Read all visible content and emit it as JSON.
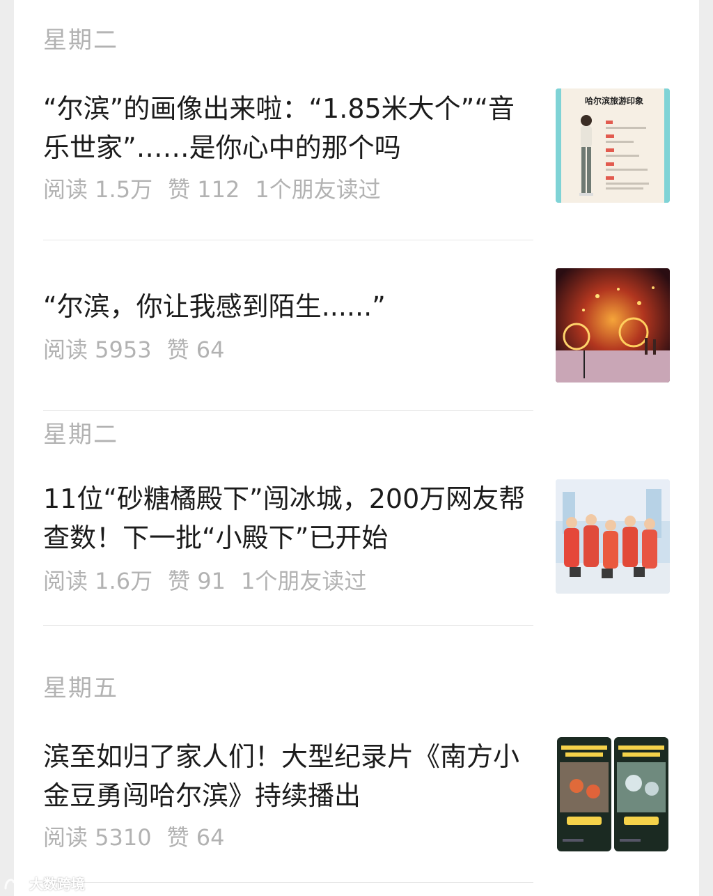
{
  "groups": [
    {
      "date": "星期二",
      "articles": [
        {
          "title": "“尔滨”的画像出来啦：“1.85米大个”“音乐世家”……是你心中的那个吗",
          "reads": "阅读 1.5万",
          "likes": "赞 112",
          "friends": "1个朋友读过",
          "thumb": {
            "caption": "哈尔滨旅游印象"
          }
        },
        {
          "title": "“尔滨，你让我感到陌生......”",
          "reads": "阅读 5953",
          "likes": "赞 64",
          "friends": ""
        }
      ]
    },
    {
      "date": "星期二",
      "articles": [
        {
          "title": "11位“砂糖橘殿下”闯冰城，200万网友帮查数！下一批“小殿下”已开始",
          "reads": "阅读 1.6万",
          "likes": "赞 91",
          "friends": "1个朋友读过"
        }
      ]
    },
    {
      "date": "星期五",
      "articles": [
        {
          "title": "滨至如归了家人们！大型纪录片《南方小金豆勇闯哈尔滨》持续播出",
          "reads": "阅读 5310",
          "likes": "赞 64",
          "friends": ""
        }
      ]
    }
  ],
  "watermark": {
    "text": "大数跨境"
  },
  "colors": {
    "background": "#ededed",
    "card": "#ffffff",
    "title": "#1b1b1b",
    "meta": "#b2b2b2",
    "divider": "#e5e5e5"
  }
}
